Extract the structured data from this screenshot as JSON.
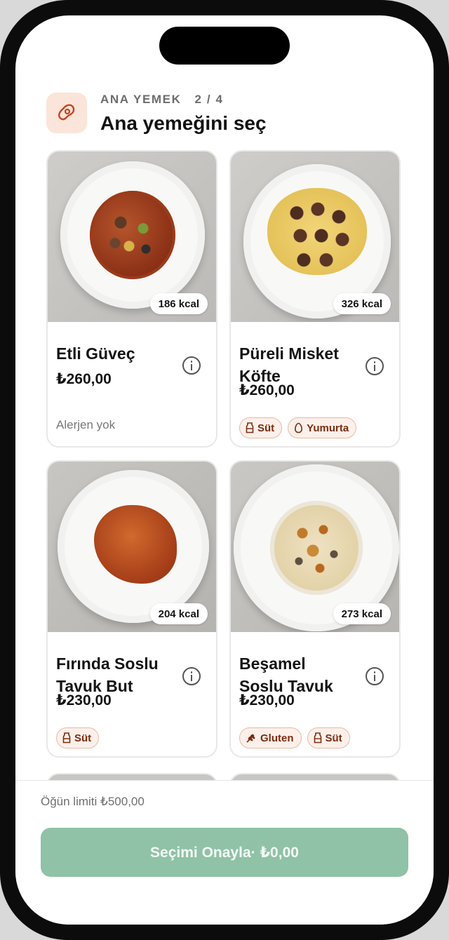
{
  "header": {
    "step_label": "ANA YEMEK",
    "step_counter": "2 / 4",
    "title": "Ana yemeğini seç",
    "icon": "meat-icon"
  },
  "dishes": [
    {
      "name": "Etli Güveç",
      "price": "₺260,00",
      "kcal": "186 kcal",
      "allergen_text": "Alerjen yok",
      "allergens": []
    },
    {
      "name": "Püreli Misket Köfte",
      "price": "₺260,00",
      "kcal": "326 kcal",
      "allergens": [
        {
          "label": "Süt",
          "icon": "milk-bottle-icon"
        },
        {
          "label": "Yumurta",
          "icon": "egg-icon"
        }
      ]
    },
    {
      "name": "Fırında Soslu Tavuk But",
      "price": "₺230,00",
      "kcal": "204 kcal",
      "allergens": [
        {
          "label": "Süt",
          "icon": "milk-bottle-icon"
        }
      ]
    },
    {
      "name": "Beşamel Soslu Tavuk",
      "price": "₺230,00",
      "kcal": "273 kcal",
      "allergens": [
        {
          "label": "Gluten",
          "icon": "wheat-icon"
        },
        {
          "label": "Süt",
          "icon": "milk-bottle-icon"
        }
      ]
    }
  ],
  "footer": {
    "limit_text": "Öğün limiti ₺500,00",
    "confirm_label": "Seçimi Onayla· ₺0,00"
  },
  "colors": {
    "accent": "#8fc2a6",
    "tag_bg": "#fdf0ea",
    "tag_text": "#7c2d10",
    "icon_bg": "#fbe4da"
  }
}
